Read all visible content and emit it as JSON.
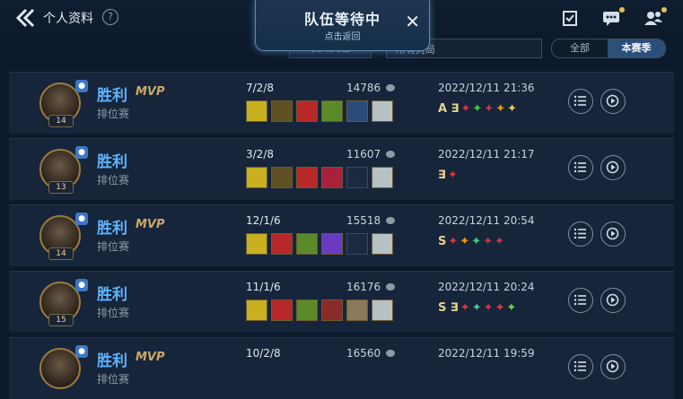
{
  "header": {
    "title": "个人资料",
    "help_label": "?",
    "queue_title": "队伍等待中",
    "queue_subtitle": "点击返回",
    "queue_close": "✕",
    "icons": [
      "back-arrow-icon",
      "task-icon",
      "chat-icon",
      "friends-icon"
    ]
  },
  "filters": {
    "hero_filter": "我的英雄",
    "match_filter": "所有对局",
    "segment_all": "全部",
    "segment_season": "本赛季"
  },
  "matches": [
    {
      "result": "胜利",
      "mvp": "MVP",
      "mode": "排位赛",
      "level": "14",
      "kda": "7/2/8",
      "gold": "14786",
      "date": "2022/12/11 21:36",
      "tags": "A ∃",
      "items": [
        "#c8b020",
        "#5e5020",
        "#b82828",
        "#5b8a2a",
        "#2a4a7a",
        "#b7c1c4"
      ],
      "tag_icons": [
        "#d34",
        "#4c4",
        "#c34",
        "#e90",
        "#ec6"
      ]
    },
    {
      "result": "胜利",
      "mvp": "",
      "mode": "排位赛",
      "level": "13",
      "kda": "3/2/8",
      "gold": "11607",
      "date": "2022/12/11 21:17",
      "tags": "∃",
      "items": [
        "#c8b020",
        "#5e5020",
        "#b82828",
        "#a8203a",
        "",
        "#b7c1c4"
      ],
      "tag_icons": [
        "#d34"
      ]
    },
    {
      "result": "胜利",
      "mvp": "MVP",
      "mode": "排位赛",
      "level": "14",
      "kda": "12/1/6",
      "gold": "15518",
      "date": "2022/12/11 20:54",
      "tags": "S",
      "items": [
        "#c8b020",
        "#b82828",
        "#5b8a2a",
        "#6b3ac2",
        "",
        "#b7c1c4"
      ],
      "tag_icons": [
        "#d34",
        "#e90",
        "#4c8",
        "#c34",
        "#c34"
      ]
    },
    {
      "result": "胜利",
      "mvp": "",
      "mode": "排位赛",
      "level": "15",
      "kda": "11/1/6",
      "gold": "16176",
      "date": "2022/12/11 20:24",
      "tags": "S ∃",
      "items": [
        "#c8b020",
        "#b82828",
        "#5b8a2a",
        "#8a2a2a",
        "#8a7a5a",
        "#b7c1c4"
      ],
      "tag_icons": [
        "#d34",
        "#4c8",
        "#c34",
        "#d34",
        "#7c5"
      ]
    },
    {
      "result": "胜利",
      "mvp": "MVP",
      "mode": "排位赛",
      "level": "",
      "kda": "10/2/8",
      "gold": "16560",
      "date": "2022/12/11 19:59",
      "tags": "",
      "items": [],
      "tag_icons": []
    }
  ]
}
